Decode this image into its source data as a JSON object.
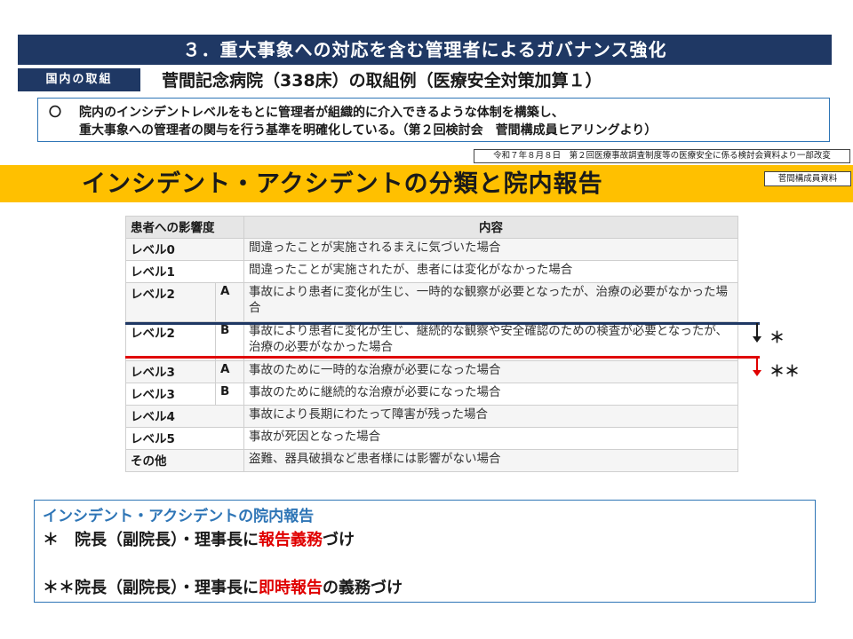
{
  "header": {
    "title": "３．重大事象への対応を含む管理者によるガバナンス強化",
    "badge": "国内の取組",
    "example_heading": "菅間記念病院（338床）の取組例（医療安全対策加算１）"
  },
  "summary": {
    "bullet": "〇",
    "line1": "院内のインシデントレベルをもとに管理者が組織的に介入できるような体制を構築し、",
    "line2": "重大事象への管理者の関与を行う基準を明確化している。（第２回検討会　菅間構成員ヒアリングより）"
  },
  "source_note": "令和７年８月８日　第２回医療事故調査制度等の医療安全に係る検討会資料より一部改変",
  "band": {
    "title": "インシデント・アクシデントの分類と院内報告",
    "material_label": "菅間構成員資料"
  },
  "table": {
    "headers": [
      "患者への影響度",
      "内容"
    ],
    "rows": [
      {
        "level": "レベル0",
        "sub": "",
        "content": "間違ったことが実施されるまえに気づいた場合"
      },
      {
        "level": "レベル1",
        "sub": "",
        "content": "間違ったことが実施されたが、患者には変化がなかった場合"
      },
      {
        "level": "レベル2",
        "sub": "A",
        "content": "事故により患者に変化が生じ、一時的な観察が必要となったが、治療の必要がなかった場合"
      },
      {
        "level": "レベル2",
        "sub": "B",
        "content": "事故により患者に変化が生じ、継続的な観察や安全確認のための検査が必要となったが、治療の必要がなかった場合"
      },
      {
        "level": "レベル3",
        "sub": "A",
        "content": "事故のために一時的な治療が必要になった場合"
      },
      {
        "level": "レベル3",
        "sub": "B",
        "content": "事故のために継続的な治療が必要になった場合"
      },
      {
        "level": "レベル4",
        "sub": "",
        "content": "事故により長期にわたって障害が残った場合"
      },
      {
        "level": "レベル5",
        "sub": "",
        "content": "事故が死因となった場合"
      },
      {
        "level": "その他",
        "sub": "",
        "content": "盗難、器具破損など患者様には影響がない場合"
      }
    ]
  },
  "markers": {
    "single": "＊",
    "double": "＊＊"
  },
  "report": {
    "title": "インシデント・アクシデントの院内報告",
    "line1_prefix": "＊　院長（副院長）・理事長に",
    "line1_emphasis": "報告義務",
    "line1_suffix": "づけ",
    "line2_prefix": "＊＊院長（副院長）・理事長に",
    "line2_emphasis": "即時報告",
    "line2_suffix": "の義務づけ"
  },
  "colors": {
    "navy": "#1f3864",
    "band_yellow": "#ffc000",
    "emphasis_red": "#e00000",
    "box_blue": "#2e75b6"
  }
}
